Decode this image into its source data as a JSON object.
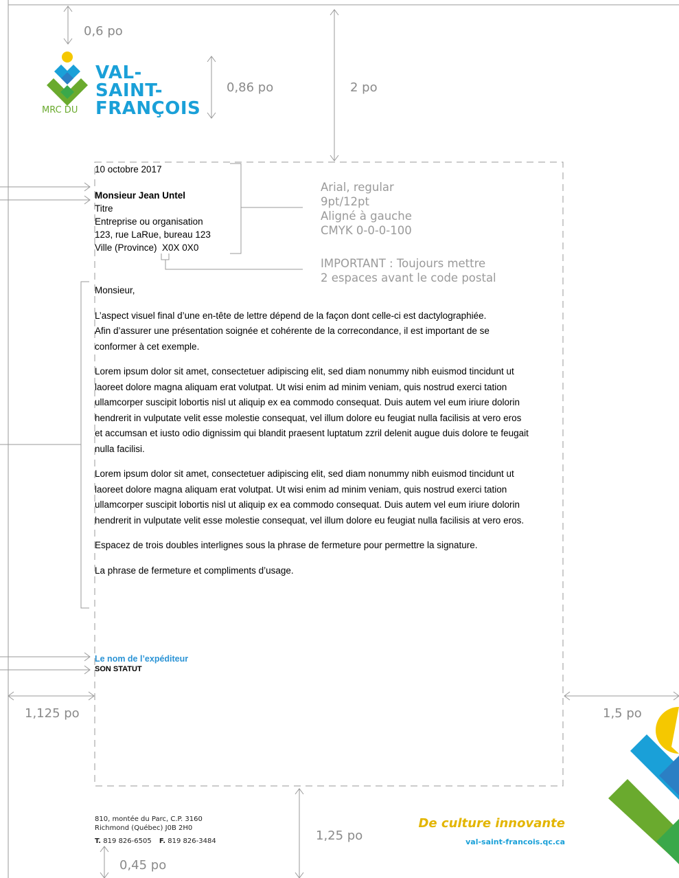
{
  "logo": {
    "line1": "VAL-",
    "line2": "SAINT-",
    "line3": "FRANÇOIS",
    "prefix": "MRC DU"
  },
  "dimensions": {
    "top_margin": "0,6 po",
    "logo_height": "0,86 po",
    "header_height": "2 po",
    "left_margin": "1,125 po",
    "right_margin": "1,5 po",
    "bottom_margin": "1,25 po",
    "footer_offset": "0,45 po"
  },
  "spec_note": {
    "line1": "Arial, regular",
    "line2": "9pt/12pt",
    "line3": "Aligné à gauche",
    "line4": "CMYK 0-0-0-100"
  },
  "important_note": {
    "line1": "IMPORTANT : Toujours mettre",
    "line2": "2 espaces avant le code postal"
  },
  "letter": {
    "date": "10 octobre 2017",
    "recipient_name": "Monsieur Jean Untel",
    "recipient_title": "Titre",
    "company": "Entreprise ou organisation",
    "address": "123, rue LaRue, bureau 123",
    "city_postal": "Ville (Province)  X0X 0X0",
    "salutation": "Monsieur,",
    "para1_l1": "L’aspect visuel final d’une en-tête de lettre dépend de la façon dont celle-ci est dactylographiée.",
    "para1_l2": "Afin d’assurer une présentation soignée et cohérente de la correcondance, il est important de se",
    "para1_l3": "conformer à cet exemple.",
    "para2_l1": "Lorem ipsum dolor sit amet, consectetuer adipiscing elit, sed diam nonummy nibh euismod tincidunt ut",
    "para2_l2": "laoreet dolore magna aliquam erat volutpat. Ut wisi enim ad minim veniam, quis nostrud exerci tation",
    "para2_l3": "ullamcorper suscipit lobortis nisl ut aliquip ex ea commodo consequat. Duis autem vel eum iriure dolorin",
    "para2_l4": "hendrerit in vulputate velit esse molestie consequat, vel illum dolore eu feugiat nulla facilisis at vero eros",
    "para2_l5": "et accumsan et iusto odio dignissim qui blandit praesent luptatum zzril delenit augue duis dolore te feugait",
    "para2_l6": "nulla facilisi.",
    "para3_l1": "Lorem ipsum dolor sit amet, consectetuer adipiscing elit, sed diam nonummy nibh euismod tincidunt ut",
    "para3_l2": "laoreet dolore magna aliquam erat volutpat. Ut wisi enim ad minim veniam, quis nostrud exerci tation",
    "para3_l3": "ullamcorper suscipit lobortis nisl ut aliquip ex ea commodo consequat. Duis autem vel eum iriure dolorin",
    "para3_l4": "hendrerit in vulputate velit esse molestie consequat, vel illum dolore eu feugiat nulla facilisis at vero eros.",
    "para4": "Espacez de trois doubles interlignes sous la phrase de fermeture pour permettre la signature.",
    "closing": "La phrase de fermeture et compliments d’usage.",
    "sender_name": "Le nom de l’expéditeur",
    "sender_status": "SON STATUT"
  },
  "footer": {
    "address_l1": "810, montée du Parc, C.P. 3160",
    "address_l2": "Richmond (Québec)  J0B 2H0",
    "tel_label": "T.",
    "tel": "819 826-6505",
    "fax_label": "F.",
    "fax": "819 826-3484",
    "tagline": "De culture innovante",
    "website": "val-saint-francois.qc.ca"
  },
  "colors": {
    "blue": "#1aa0d8",
    "green": "#6aaa2e",
    "yellow": "#f5c800",
    "guide_gray": "#9a9a9a"
  }
}
